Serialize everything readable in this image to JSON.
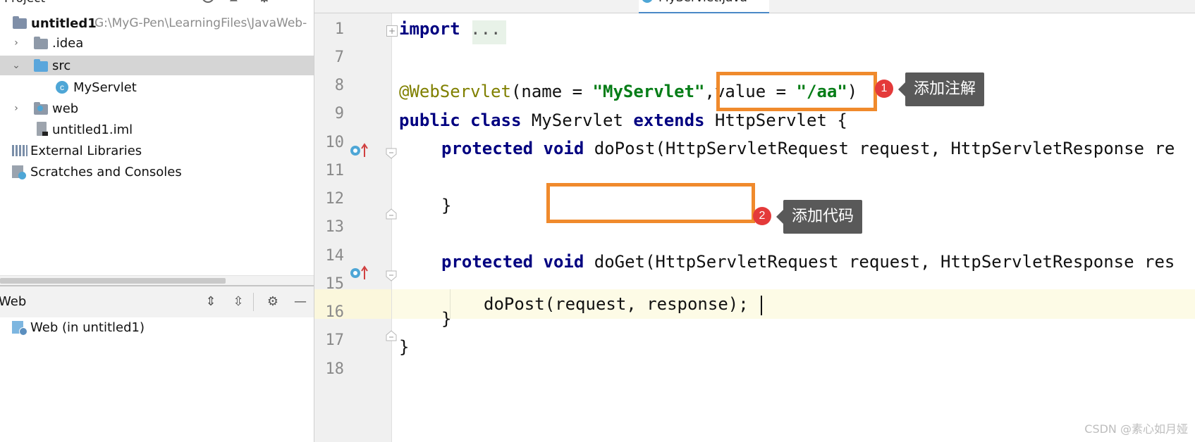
{
  "project_panel": {
    "header": "Project",
    "tree": [
      {
        "label": "untitled1",
        "path": "G:\\MyG-Pen\\LearningFiles\\JavaWeb-"
      },
      {
        "label": ".idea"
      },
      {
        "label": "src"
      },
      {
        "label": "MyServlet"
      },
      {
        "label": "web"
      },
      {
        "label": "untitled1.iml"
      },
      {
        "label": "External Libraries"
      },
      {
        "label": "Scratches and Consoles"
      }
    ]
  },
  "web_panel": {
    "title": "Web",
    "items": [
      {
        "label": "Web (in untitled1)"
      }
    ]
  },
  "editor": {
    "tab": "MyServlet.java",
    "line_numbers": [
      "1",
      "7",
      "8",
      "9",
      "10",
      "11",
      "12",
      "13",
      "14",
      "15",
      "16",
      "17",
      "18"
    ],
    "code": {
      "l1_kw": "import",
      "l1_fold": " ...",
      "l8_ann": "@WebServlet",
      "l8_a": "(name = ",
      "l8_s1": "\"MyServlet\"",
      "l8_b": ",value = ",
      "l8_s2": "\"/aa\"",
      "l8_c": ")",
      "l9_kw1": "public",
      "l9_kw2": "class",
      "l9_a": " MyServlet ",
      "l9_kw3": "extends",
      "l9_b": " HttpServlet {",
      "l10_kw1": "protected",
      "l10_kw2": "void",
      "l10_a": " doPost(HttpServletRequest request, HttpServletResponse re",
      "l12": "}",
      "l14_kw1": "protected",
      "l14_kw2": "void",
      "l14_a": " doGet(HttpServletRequest request, HttpServletResponse res",
      "l15": "doPost(request, response);",
      "l16": "}",
      "l17": "}"
    }
  },
  "annotations": [
    {
      "number": "1",
      "text": "添加注解"
    },
    {
      "number": "2",
      "text": "添加代码"
    }
  ],
  "watermark": "CSDN @素心如月娅",
  "colors": {
    "highlight_box": "#f08a2c",
    "badge": "#e43a3a",
    "tooltip_bg": "#595959",
    "keyword": "#000080",
    "string": "#067d17"
  }
}
